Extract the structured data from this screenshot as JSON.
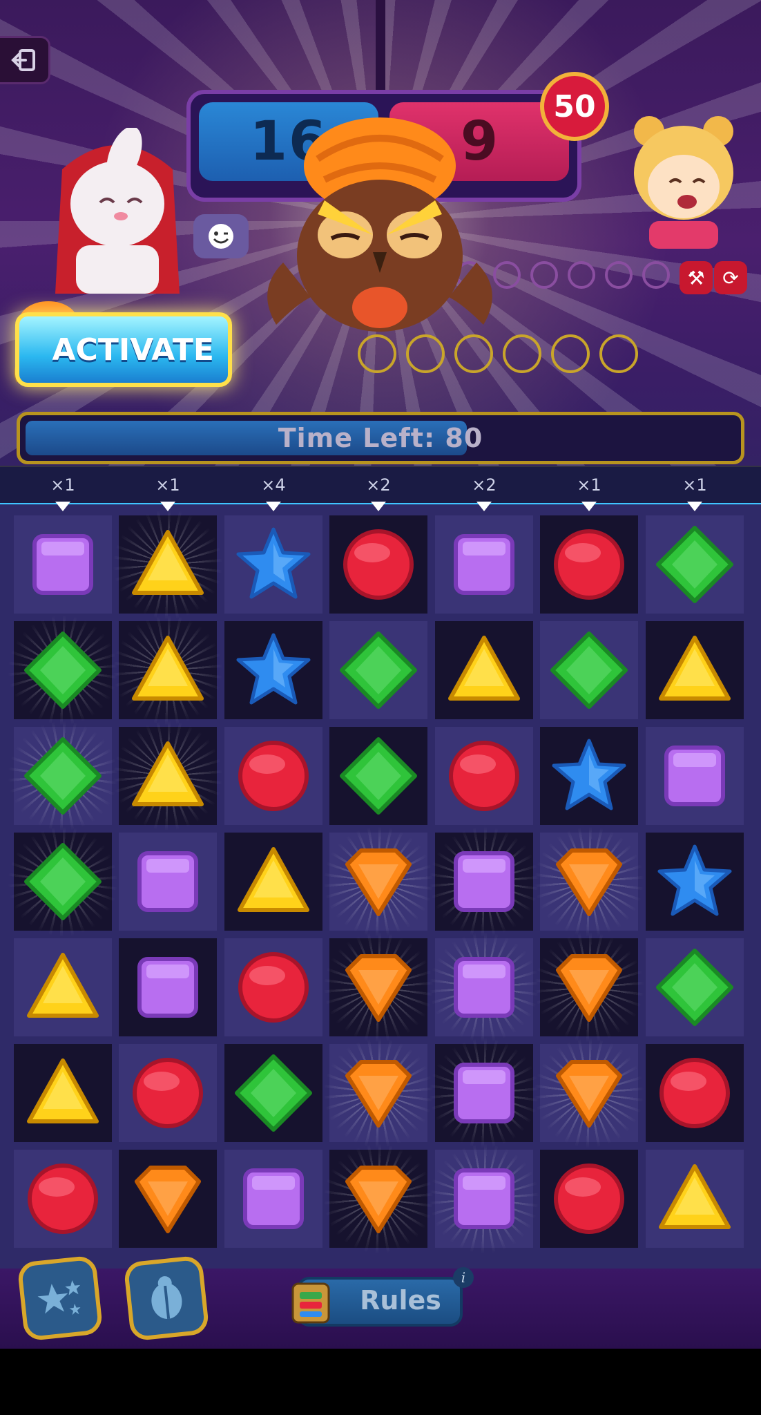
{
  "scores": {
    "left": "16",
    "right": "9",
    "target": "50"
  },
  "activate": {
    "label": "ACTIVATE"
  },
  "timer": {
    "label": "Time Left: 80",
    "fill_fraction": 0.62
  },
  "multipliers": [
    "×1",
    "×1",
    "×4",
    "×2",
    "×2",
    "×1",
    "×1"
  ],
  "board": {
    "rows": [
      [
        "purple-square",
        "yellow-triangle",
        "blue-star",
        "red-circle",
        "purple-square",
        "red-circle",
        "green-diamond"
      ],
      [
        "green-diamond",
        "yellow-triangle",
        "blue-star",
        "green-diamond",
        "yellow-triangle",
        "green-diamond",
        "yellow-triangle"
      ],
      [
        "green-diamond",
        "yellow-triangle",
        "red-circle",
        "green-diamond",
        "red-circle",
        "blue-star",
        "purple-square"
      ],
      [
        "green-diamond",
        "purple-square",
        "yellow-triangle",
        "orange-gem",
        "purple-square",
        "orange-gem",
        "blue-star"
      ],
      [
        "yellow-triangle",
        "purple-square",
        "red-circle",
        "orange-gem",
        "purple-square",
        "orange-gem",
        "green-diamond"
      ],
      [
        "yellow-triangle",
        "red-circle",
        "green-diamond",
        "orange-gem",
        "purple-square",
        "orange-gem",
        "red-circle"
      ],
      [
        "red-circle",
        "orange-gem",
        "purple-square",
        "orange-gem",
        "purple-square",
        "red-circle",
        "yellow-triangle"
      ]
    ]
  },
  "rules": {
    "label": "Rules"
  },
  "colors": {
    "purple": "#b86ef0",
    "yellow": "#ffd21a",
    "blue": "#2f8cf0",
    "red": "#e8243c",
    "green": "#2fc43a",
    "orange": "#ff8a1a"
  }
}
